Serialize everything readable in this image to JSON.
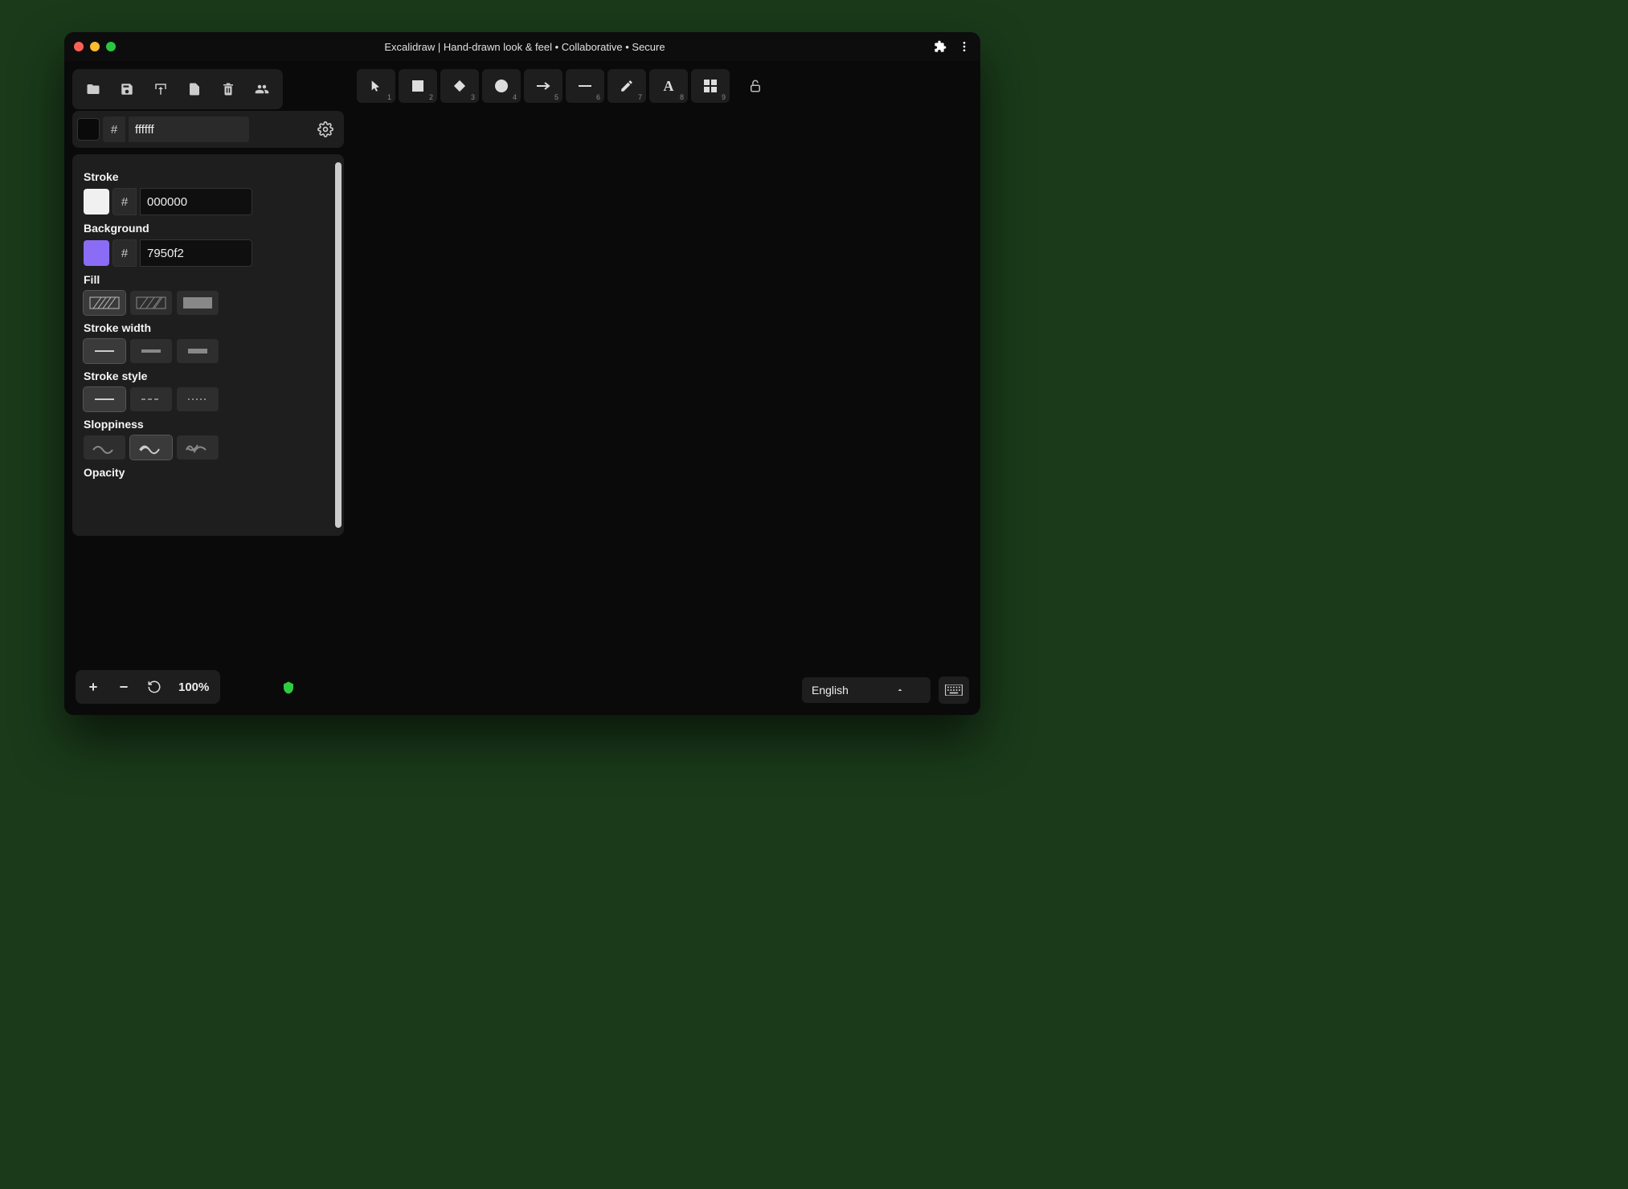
{
  "window": {
    "title": "Excalidraw | Hand-drawn look & feel • Collaborative • Secure"
  },
  "file_toolbar": {
    "open": "open",
    "save": "save",
    "export": "export",
    "import": "import",
    "trash": "trash",
    "collab": "collab"
  },
  "canvas_bg": {
    "hash": "#",
    "value": "ffffff"
  },
  "props": {
    "stroke_label": "Stroke",
    "stroke_color": {
      "hash": "#",
      "value": "000000",
      "swatch": "#f0f0f0"
    },
    "bg_label": "Background",
    "bg_color": {
      "hash": "#",
      "value": "7950f2",
      "swatch": "#7950f2"
    },
    "fill_label": "Fill",
    "stroke_width_label": "Stroke width",
    "stroke_style_label": "Stroke style",
    "sloppy_label": "Sloppiness",
    "opacity_label": "Opacity"
  },
  "tools": [
    {
      "name": "selection",
      "num": "1"
    },
    {
      "name": "rectangle",
      "num": "2"
    },
    {
      "name": "diamond",
      "num": "3"
    },
    {
      "name": "ellipse",
      "num": "4"
    },
    {
      "name": "arrow",
      "num": "5"
    },
    {
      "name": "line",
      "num": "6"
    },
    {
      "name": "draw",
      "num": "7"
    },
    {
      "name": "text",
      "num": "8"
    },
    {
      "name": "grid",
      "num": "9"
    }
  ],
  "zoom": {
    "level": "100%"
  },
  "language": {
    "selected": "English"
  }
}
